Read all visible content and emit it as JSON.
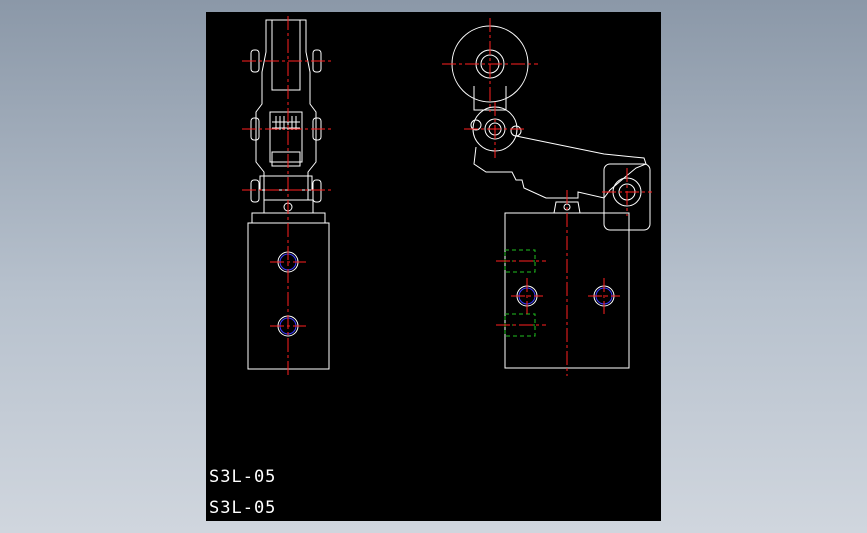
{
  "drawing": {
    "part_label_1": "S3L-05",
    "part_label_2": "S3L-05"
  },
  "colors": {
    "background": "#8b98a8",
    "canvas": "#000000",
    "outline": "#ffffff",
    "centerline": "#ff2020",
    "hidden": "#1fbf1f",
    "hole_edge": "#3b3bff"
  }
}
